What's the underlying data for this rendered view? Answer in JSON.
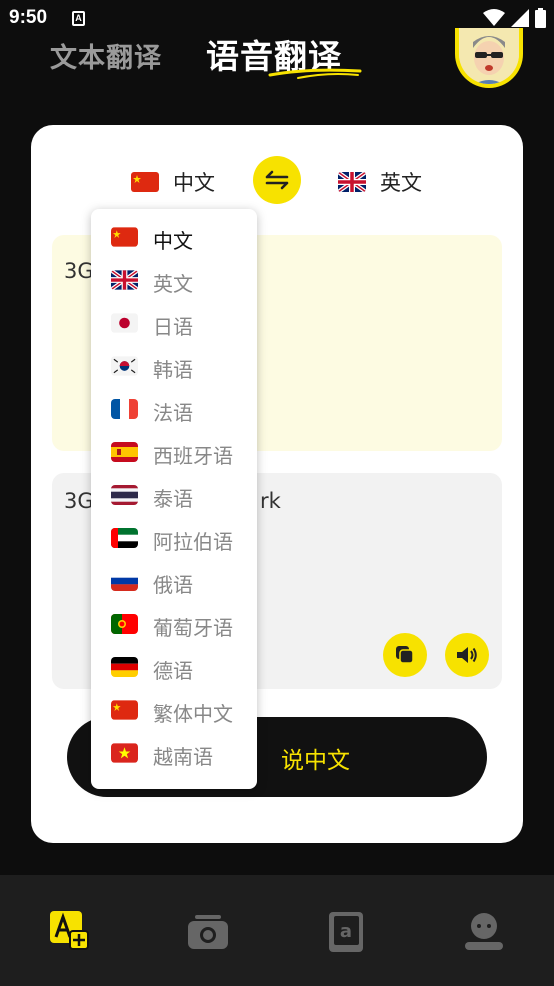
{
  "status": {
    "time": "9:50",
    "a_icon": "A"
  },
  "header": {
    "tab_text": "文本翻译",
    "tab_voice": "语音翻译"
  },
  "lang_row": {
    "source": {
      "label": "中文",
      "flag": "cn-flag-icon"
    },
    "target": {
      "label": "英文",
      "flag": "gb-flag-icon"
    }
  },
  "source_text": "3G",
  "target_text": "3G",
  "target_text_tail": "rk",
  "speak_button": "说中文",
  "dropdown": {
    "items": [
      {
        "label": "中文",
        "flag": "cn"
      },
      {
        "label": "英文",
        "flag": "gb"
      },
      {
        "label": "日语",
        "flag": "jp"
      },
      {
        "label": "韩语",
        "flag": "kr"
      },
      {
        "label": "法语",
        "flag": "fr"
      },
      {
        "label": "西班牙语",
        "flag": "es"
      },
      {
        "label": "泰语",
        "flag": "th"
      },
      {
        "label": "阿拉伯语",
        "flag": "ae"
      },
      {
        "label": "俄语",
        "flag": "ru"
      },
      {
        "label": "葡萄牙语",
        "flag": "pt"
      },
      {
        "label": "德语",
        "flag": "de"
      },
      {
        "label": "繁体中文",
        "flag": "cn"
      },
      {
        "label": "越南语",
        "flag": "vn"
      }
    ],
    "selected_index": 0
  },
  "colors": {
    "accent": "#f7e200",
    "bg": "#0d0d0d",
    "card": "#ffffff"
  },
  "bottom_nav": [
    "translate-icon",
    "camera-icon",
    "dictionary-icon",
    "profile-icon"
  ]
}
